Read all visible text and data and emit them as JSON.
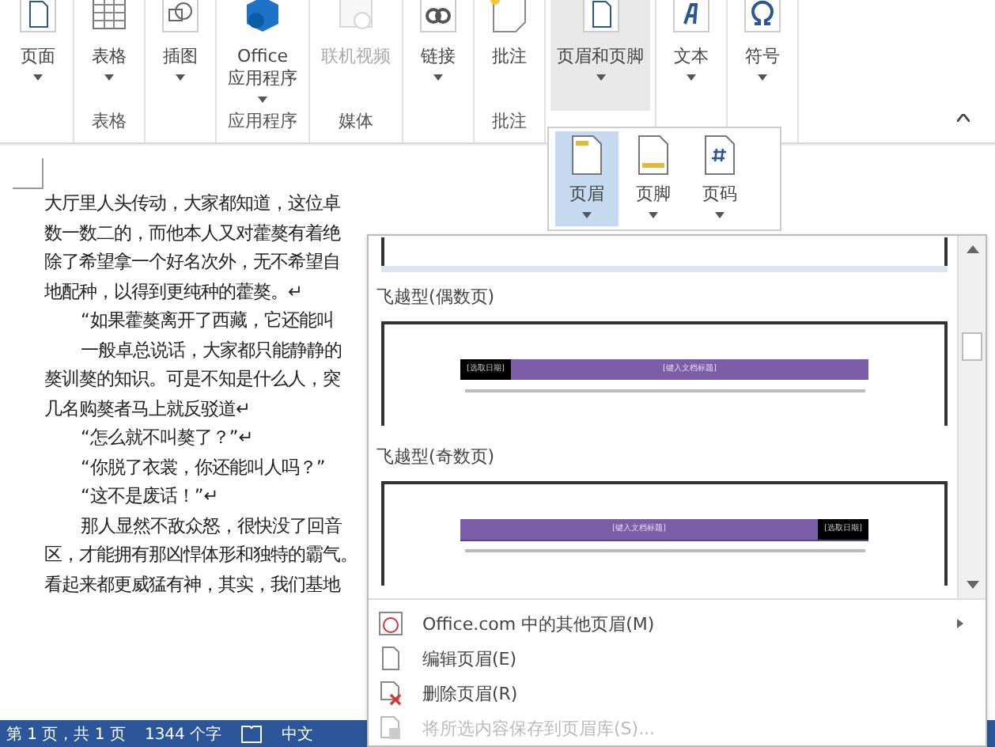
{
  "ribbon": {
    "groups": [
      {
        "buttons": [
          {
            "label": [
              "页面"
            ],
            "dropdown": true,
            "disabled": false,
            "selected": false
          }
        ]
      },
      {
        "label": "表格",
        "buttons": [
          {
            "label": [
              "表格"
            ],
            "dropdown": true,
            "disabled": false,
            "selected": false
          }
        ]
      },
      {
        "buttons": [
          {
            "label": [
              "插图"
            ],
            "dropdown": true,
            "disabled": false,
            "selected": false
          }
        ]
      },
      {
        "label": "应用程序",
        "buttons": [
          {
            "label": [
              "Office",
              "应用程序"
            ],
            "dropdown": true,
            "disabled": false,
            "selected": false
          }
        ]
      },
      {
        "label": "媒体",
        "buttons": [
          {
            "label": [
              "联机视频"
            ],
            "dropdown": false,
            "disabled": true,
            "selected": false
          }
        ]
      },
      {
        "buttons": [
          {
            "label": [
              "链接"
            ],
            "dropdown": true,
            "disabled": false,
            "selected": false
          }
        ]
      },
      {
        "label": "批注",
        "buttons": [
          {
            "label": [
              "批注"
            ],
            "dropdown": false,
            "disabled": false,
            "selected": false
          }
        ]
      },
      {
        "buttons": [
          {
            "label": [
              "页眉和页脚"
            ],
            "dropdown": true,
            "disabled": false,
            "selected": true
          }
        ]
      },
      {
        "buttons": [
          {
            "label": [
              "文本"
            ],
            "dropdown": true,
            "disabled": false,
            "selected": false
          }
        ]
      },
      {
        "buttons": [
          {
            "label": [
              "符号"
            ],
            "dropdown": true,
            "disabled": false,
            "selected": false
          }
        ]
      }
    ]
  },
  "header_footer_menu": [
    {
      "label": "页眉",
      "selected": true
    },
    {
      "label": "页脚",
      "selected": false
    },
    {
      "label": "页码",
      "selected": false
    }
  ],
  "document": {
    "lines": [
      {
        "text": "大厅里人头传动，大家都知道，这位卓",
        "indent": false
      },
      {
        "text": "数一数二的，而他本人又对藿獒有着绝",
        "indent": false
      },
      {
        "text": "除了希望拿一个好名次外，无不希望自",
        "indent": false
      },
      {
        "text": "地配种，以得到更纯种的藿獒。↵",
        "indent": false
      },
      {
        "text": "“如果藿獒离开了西藏，它还能叫",
        "indent": true
      },
      {
        "text": "一般卓总说话，大家都只能静静的",
        "indent": true
      },
      {
        "text": "獒训獒的知识。可是不知是什么人，突",
        "indent": false
      },
      {
        "text": "几名购獒者马上就反驳道↵",
        "indent": false
      },
      {
        "text": "“怎么就不叫獒了？”↵",
        "indent": true
      },
      {
        "text": "“你脱了衣裳，你还能叫人吗？”",
        "indent": true
      },
      {
        "text": "“这不是废话！”↵",
        "indent": true
      },
      {
        "text": "那人显然不敌众怒，很快没了回音",
        "indent": true
      },
      {
        "text": "区，才能拥有那凶悍体形和独特的霸气。",
        "indent": false
      },
      {
        "text": "看起来都更威猛有神，其实，我们基地",
        "indent": false
      }
    ]
  },
  "gallery": {
    "items": [
      {
        "title": "飞越型(偶数页)",
        "date": "[选取日期]",
        "doc_title": "[键入文档标题]",
        "date_on_right": false
      },
      {
        "title": "飞越型(奇数页)",
        "date": "[选取日期]",
        "doc_title": "[键入文档标题]",
        "date_on_right": true
      }
    ],
    "commands": [
      {
        "label": "Office.com 中的其他页眉(M)",
        "submenu": true,
        "disabled": false
      },
      {
        "label": "编辑页眉(E)",
        "submenu": false,
        "disabled": false
      },
      {
        "label": "删除页眉(R)",
        "submenu": false,
        "disabled": false
      },
      {
        "label": "将所选内容保存到页眉库(S)...",
        "submenu": false,
        "disabled": true
      }
    ]
  },
  "status_bar": {
    "page": "第 1 页，共 1 页",
    "words": "1344 个字",
    "language": "中文"
  }
}
